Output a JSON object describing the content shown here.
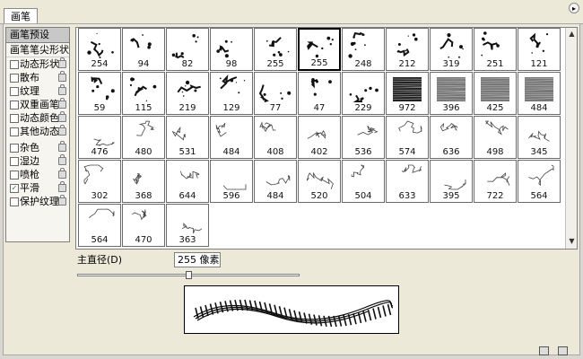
{
  "panel": {
    "tab_label": "画笔",
    "menu_icon": "panel-menu-arrow-icon"
  },
  "sidebar": {
    "header": "画笔预设",
    "tip_shape": "画笔笔尖形状",
    "items": [
      {
        "label": "动态形状",
        "checked": false
      },
      {
        "label": "散布",
        "checked": false
      },
      {
        "label": "纹理",
        "checked": false
      },
      {
        "label": "双重画笔",
        "checked": false
      },
      {
        "label": "动态颜色",
        "checked": false
      },
      {
        "label": "其他动态",
        "checked": false
      },
      {
        "label": "杂色",
        "checked": false
      },
      {
        "label": "湿边",
        "checked": false
      },
      {
        "label": "喷枪",
        "checked": false
      },
      {
        "label": "平滑",
        "checked": true
      },
      {
        "label": "保护纹理",
        "checked": false
      }
    ]
  },
  "brushes": [
    {
      "size": "254"
    },
    {
      "size": "94"
    },
    {
      "size": "82"
    },
    {
      "size": "98"
    },
    {
      "size": "255"
    },
    {
      "size": "255",
      "selected": true
    },
    {
      "size": "248"
    },
    {
      "size": "212"
    },
    {
      "size": "319"
    },
    {
      "size": "251"
    },
    {
      "size": "121"
    },
    {
      "size": "59"
    },
    {
      "size": "115"
    },
    {
      "size": "219"
    },
    {
      "size": "129"
    },
    {
      "size": "77"
    },
    {
      "size": "47"
    },
    {
      "size": "229"
    },
    {
      "size": "972"
    },
    {
      "size": "396"
    },
    {
      "size": "425"
    },
    {
      "size": "484"
    },
    {
      "size": "476"
    },
    {
      "size": "480"
    },
    {
      "size": "531"
    },
    {
      "size": "484"
    },
    {
      "size": "408"
    },
    {
      "size": "402"
    },
    {
      "size": "536"
    },
    {
      "size": "574"
    },
    {
      "size": "636"
    },
    {
      "size": "498"
    },
    {
      "size": "345"
    },
    {
      "size": "302"
    },
    {
      "size": "368"
    },
    {
      "size": "644"
    },
    {
      "size": "596"
    },
    {
      "size": "484"
    },
    {
      "size": "520"
    },
    {
      "size": "504"
    },
    {
      "size": "633"
    },
    {
      "size": "395"
    },
    {
      "size": "722"
    },
    {
      "size": "564"
    },
    {
      "size": "564"
    },
    {
      "size": "470"
    },
    {
      "size": "363"
    }
  ],
  "diameter": {
    "label": "主直径(D)",
    "value": "255 像素",
    "slider_fraction": 0.5
  },
  "footer": {
    "new_icon": "new-brush-icon",
    "delete_icon": "trash-icon"
  }
}
